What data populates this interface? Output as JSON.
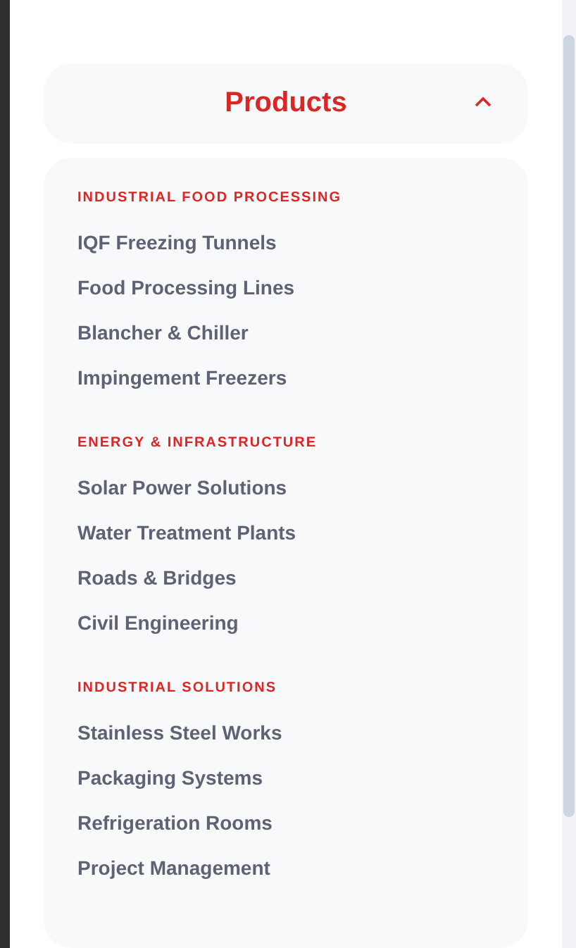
{
  "menu": {
    "title": "Products",
    "expanded": true,
    "sections": [
      {
        "heading": "INDUSTRIAL FOOD PROCESSING",
        "items": [
          "IQF Freezing Tunnels",
          "Food Processing Lines",
          "Blancher & Chiller",
          "Impingement Freezers"
        ]
      },
      {
        "heading": "ENERGY & INFRASTRUCTURE",
        "items": [
          "Solar Power Solutions",
          "Water Treatment Plants",
          "Roads & Bridges",
          "Civil Engineering"
        ]
      },
      {
        "heading": "INDUSTRIAL SOLUTIONS",
        "items": [
          "Stainless Steel Works",
          "Packaging Systems",
          "Refrigeration Rooms",
          "Project Management"
        ]
      }
    ]
  }
}
